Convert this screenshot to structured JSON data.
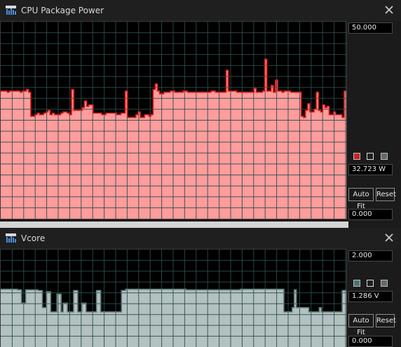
{
  "windows": [
    {
      "title": "CPU Package Power",
      "max_value": "50.000",
      "current_value": "32.723 W",
      "min_value": "0.000",
      "auto_fit_label": "Auto Fit",
      "reset_label": "Reset",
      "fill_color": "#ff9c9c",
      "line_color": "#e01a1a",
      "swatch_colors": [
        "#cc2222",
        "#1f1f1f",
        "#5d6a70"
      ],
      "chart_data": {
        "type": "area",
        "ylim": [
          0,
          50
        ],
        "grid": true,
        "values": [
          32.4,
          32.4,
          32.4,
          32.1,
          32.4,
          32.4,
          32.4,
          32.4,
          32.4,
          32.1,
          32.4,
          32.4,
          32.8,
          32.1,
          26.0,
          26.0,
          26.4,
          26.8,
          26.4,
          26.4,
          26.8,
          27.1,
          27.5,
          26.4,
          26.8,
          26.4,
          26.4,
          26.4,
          26.8,
          27.1,
          27.1,
          26.8,
          26.4,
          32.8,
          27.5,
          27.5,
          27.5,
          27.5,
          28.2,
          29.9,
          28.5,
          28.9,
          28.9,
          26.8,
          26.8,
          26.8,
          26.8,
          26.4,
          26.4,
          26.8,
          26.8,
          26.8,
          26.8,
          26.8,
          26.4,
          26.4,
          26.8,
          26.8,
          32.4,
          25.7,
          25.7,
          25.7,
          25.7,
          26.4,
          27.1,
          25.7,
          25.7,
          26.4,
          26.4,
          26.0,
          26.4,
          32.8,
          34.2,
          32.4,
          31.7,
          31.7,
          32.1,
          32.1,
          32.1,
          32.4,
          32.4,
          32.1,
          32.1,
          32.1,
          32.1,
          32.4,
          32.4,
          32.1,
          32.1,
          32.1,
          32.1,
          32.1,
          32.1,
          32.1,
          32.1,
          32.1,
          32.1,
          32.1,
          32.4,
          32.4,
          32.1,
          32.1,
          32.1,
          32.1,
          32.1,
          37.7,
          32.4,
          32.4,
          32.4,
          32.4,
          32.1,
          32.1,
          32.1,
          32.1,
          32.1,
          32.1,
          32.1,
          32.1,
          33.1,
          32.1,
          32.1,
          32.1,
          32.4,
          40.5,
          32.4,
          32.4,
          33.8,
          32.1,
          35.2,
          32.4,
          32.4,
          32.1,
          32.4,
          32.4,
          32.4,
          32.1,
          32.1,
          32.1,
          32.1,
          32.1,
          26.0,
          25.7,
          27.5,
          29.2,
          27.1,
          27.1,
          27.8,
          32.1,
          27.5,
          27.1,
          28.9,
          28.2,
          28.5,
          26.4,
          26.4,
          27.1,
          26.4,
          26.4,
          26.4,
          25.7,
          32.4
        ]
      }
    },
    {
      "title": "Vcore",
      "max_value": "2.000",
      "current_value": "1.286  V",
      "min_value": "0.000",
      "auto_fit_label": "Auto Fit",
      "reset_label": "Reset",
      "fill_color": "#b3c1c1",
      "line_color": "#5f7878",
      "swatch_colors": [
        "#4a7373",
        "#1f1f1f",
        "#5d6a70"
      ],
      "chart_data": {
        "type": "area",
        "ylim": [
          0,
          2
        ],
        "grid": true,
        "values": [
          1.186,
          1.186,
          1.186,
          1.186,
          1.186,
          1.186,
          1.186,
          1.186,
          1.174,
          1.174,
          0.901,
          0.901,
          1.174,
          1.174,
          1.174,
          1.174,
          1.174,
          1.174,
          1.16,
          1.16,
          0.808,
          0.808,
          1.135,
          1.135,
          0.72,
          0.72,
          0.72,
          1.085,
          1.085,
          0.72,
          0.901,
          0.901,
          0.72,
          0.72,
          0.72,
          1.16,
          1.16,
          0.72,
          0.72,
          0.901,
          0.901,
          0.72,
          0.72,
          0.72,
          0.72,
          0.72,
          1.16,
          1.16,
          0.72,
          0.72,
          0.72,
          0.72,
          0.72,
          0.72,
          0.72,
          0.72,
          0.72,
          0.72,
          1.16,
          1.16,
          1.186,
          1.186,
          1.186,
          1.186,
          1.186,
          1.186,
          1.186,
          1.186,
          1.186,
          1.186,
          1.186,
          1.186,
          1.186,
          1.186,
          1.186,
          1.186,
          1.186,
          1.186,
          1.186,
          1.186,
          1.186,
          1.186,
          1.186,
          1.186,
          1.186,
          1.186,
          1.186,
          1.186,
          1.186,
          1.174,
          1.174,
          1.174,
          1.174,
          1.174,
          1.174,
          1.174,
          1.174,
          1.174,
          1.174,
          1.174,
          1.174,
          1.174,
          1.174,
          1.174,
          1.174,
          1.174,
          1.174,
          1.174,
          1.174,
          1.174,
          1.174,
          1.174,
          1.174,
          1.174,
          1.174,
          1.186,
          1.186,
          1.186,
          1.186,
          1.186,
          1.186,
          1.186,
          1.186,
          1.186,
          1.186,
          1.186,
          1.186,
          1.186,
          1.186,
          1.186,
          1.186,
          1.186,
          1.186,
          1.186,
          1.186,
          1.186,
          0.72,
          0.72,
          0.72,
          0.72,
          0.808,
          1.174,
          0.808,
          0.808,
          0.808,
          0.808,
          0.808,
          0.808,
          0.72,
          0.72,
          0.72,
          0.72,
          0.72,
          0.808,
          0.72,
          0.72,
          0.72,
          0.72,
          0.72,
          0.72,
          0.72,
          0.72,
          0.72,
          0.72,
          1.16,
          1.16
        ]
      }
    }
  ]
}
